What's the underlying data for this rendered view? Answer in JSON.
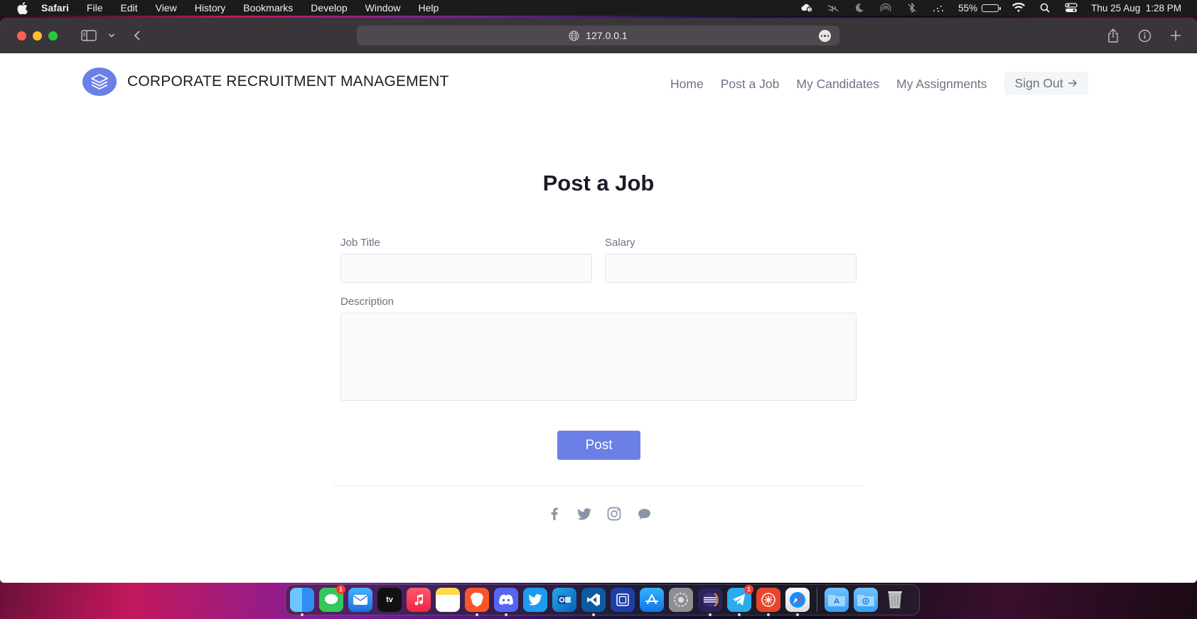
{
  "menubar": {
    "app_name": "Safari",
    "items": [
      "File",
      "Edit",
      "View",
      "History",
      "Bookmarks",
      "Develop",
      "Window",
      "Help"
    ],
    "battery_percent": "55%",
    "battery_level": 0.55,
    "datetime": "Thu 25 Aug  1:28 PM"
  },
  "browser": {
    "url": "127.0.0.1"
  },
  "site": {
    "brand": "CORPORATE RECRUITMENT MANAGEMENT",
    "nav": [
      "Home",
      "Post a Job",
      "My Candidates",
      "My Assignments"
    ],
    "signout_label": "Sign Out",
    "accent_color": "#6b7fe6"
  },
  "form": {
    "title": "Post a Job",
    "job_title_label": "Job Title",
    "job_title_value": "",
    "salary_label": "Salary",
    "salary_value": "",
    "description_label": "Description",
    "description_value": "",
    "submit_label": "Post"
  },
  "footer": {
    "social_icons": [
      "facebook-icon",
      "twitter-icon",
      "instagram-icon",
      "chat-icon"
    ]
  },
  "dock": {
    "apps": [
      "Finder",
      "Messages",
      "Mail",
      "TV",
      "Music",
      "Notes",
      "Brave",
      "Discord",
      "Twitter",
      "Outlook",
      "VS Code",
      "Simulator",
      "App Store",
      "System Preferences",
      "Eclipse",
      "Telegram",
      "Brave Beta",
      "Safari"
    ],
    "messages_badge": "1",
    "telegram_badge": "1",
    "tv_label": "tv"
  }
}
